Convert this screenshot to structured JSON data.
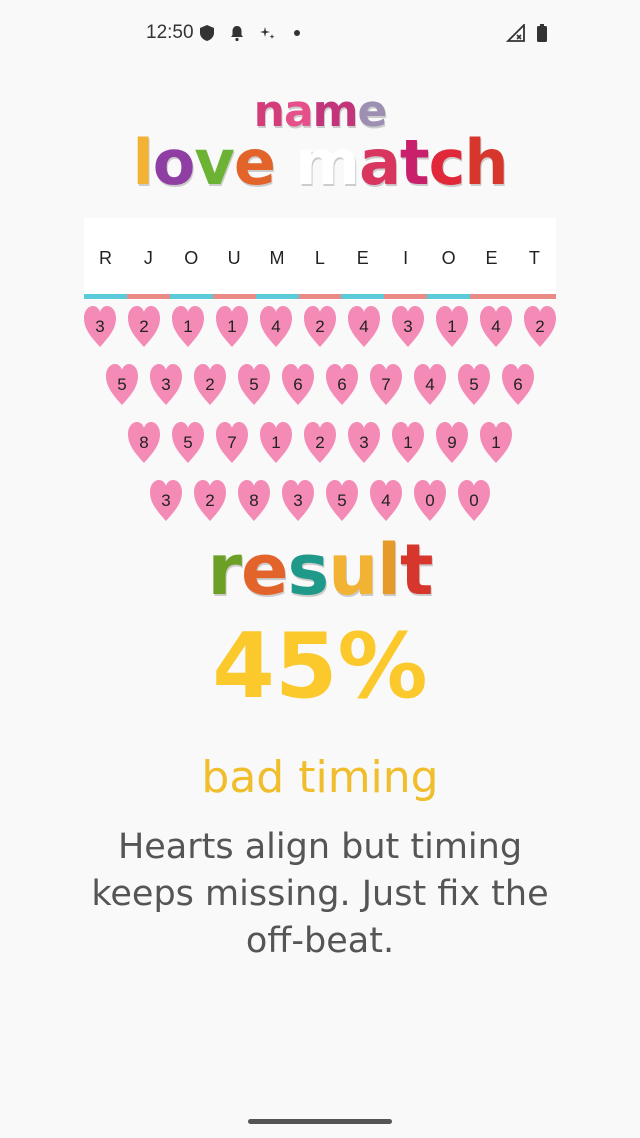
{
  "status_bar": {
    "time": "12:50",
    "icons": [
      "shield-icon",
      "bell-icon",
      "sparkle-icon",
      "dot-icon",
      "signal-icon",
      "battery-icon"
    ]
  },
  "logo": {
    "line1": "name",
    "line2": "love match",
    "result": "result"
  },
  "letters": [
    "R",
    "J",
    "O",
    "U",
    "M",
    "L",
    "E",
    "I",
    "O",
    "E",
    "T"
  ],
  "stripe_colors": [
    "#5ccbd9",
    "#ea8a86",
    "#5ccbd9",
    "#ea8a86",
    "#5ccbd9",
    "#ea8a86",
    "#5ccbd9",
    "#ea8a86",
    "#5ccbd9",
    "#ea8a86",
    "#ea8a86"
  ],
  "heart_rows": [
    [
      "3",
      "2",
      "1",
      "1",
      "4",
      "2",
      "4",
      "3",
      "1",
      "4",
      "2"
    ],
    [
      "5",
      "3",
      "2",
      "5",
      "6",
      "6",
      "7",
      "4",
      "5",
      "6"
    ],
    [
      "8",
      "5",
      "7",
      "1",
      "2",
      "3",
      "1",
      "9",
      "1"
    ],
    [
      "3",
      "2",
      "8",
      "3",
      "5",
      "4",
      "0",
      "0"
    ]
  ],
  "result": {
    "percent": "45%",
    "progress_percent": 45,
    "verdict": "bad timing",
    "description": "Hearts align but timing keeps missing. Just fix the off-beat."
  },
  "colors": {
    "heart": "#f48bb6",
    "percent": "#fbc92b",
    "verdict": "#f0bd2c"
  }
}
